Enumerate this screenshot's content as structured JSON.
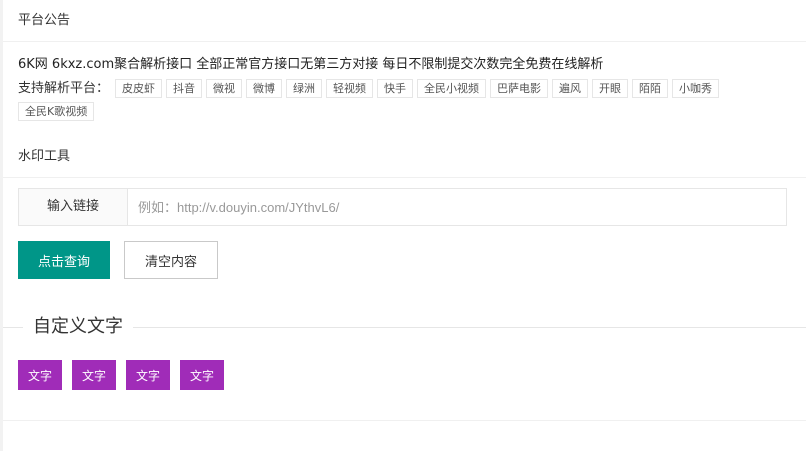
{
  "announcement": {
    "header": "平台公告",
    "text": "6K网 6kxz.com聚合解析接口 全部正常官方接口无第三方对接 每日不限制提交次数完全免费在线解析",
    "platform_label": "支持解析平台：",
    "platforms": [
      "皮皮虾",
      "抖音",
      "微视",
      "微博",
      "绿洲",
      "轻视频",
      "快手",
      "全民小视频",
      "巴萨电影",
      "遍风",
      "开眼",
      "陌陌",
      "小咖秀",
      "全民K歌视频"
    ]
  },
  "tool": {
    "header": "水印工具",
    "input_label": "输入链接",
    "input_placeholder": "例如：http://v.douyin.com/JYthvL6/",
    "input_value": "",
    "query_button": "点击查询",
    "clear_button": "清空内容"
  },
  "custom": {
    "legend": "自定义文字",
    "buttons": [
      "文字",
      "文字",
      "文字",
      "文字"
    ],
    "button_color": "#a02cb8"
  },
  "colors": {
    "primary": "#009688",
    "accent": "#a02cb8"
  }
}
